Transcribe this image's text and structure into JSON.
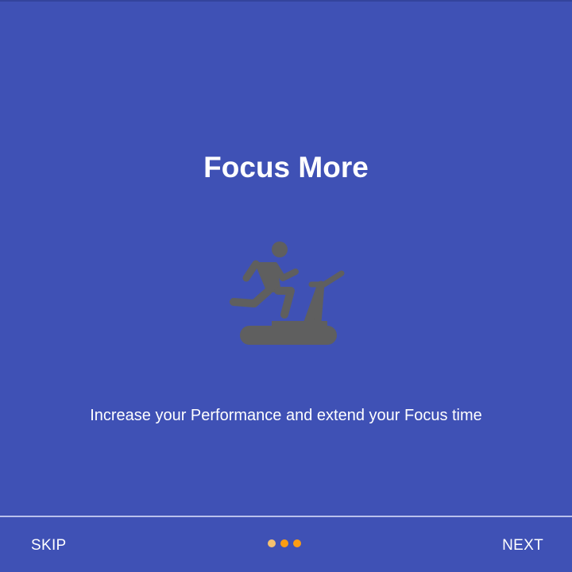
{
  "slide": {
    "title": "Focus More",
    "illustration_icon": "treadmill-runner-icon",
    "description": "Increase your Performance and extend your Focus time"
  },
  "navigation": {
    "skip_label": "SKIP",
    "next_label": "NEXT",
    "page_count": 3,
    "current_page": 3
  },
  "colors": {
    "background": "#3f51b5",
    "icon": "#5f5f5f",
    "dot_inactive": "#f5c16f",
    "dot_active": "#fb9d14"
  }
}
